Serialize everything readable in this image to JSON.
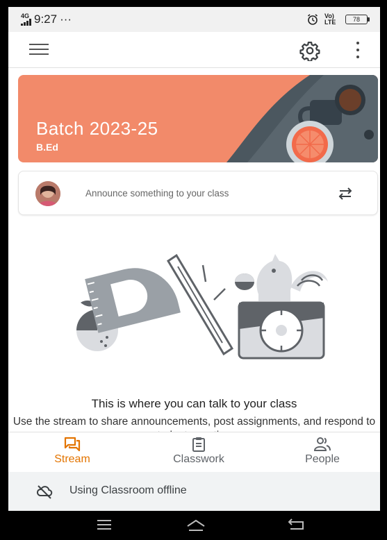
{
  "status_bar": {
    "network": "4G",
    "time": "9:27",
    "dots": "···",
    "volte": "Vo) LTE",
    "battery": "78"
  },
  "appbar": {
    "menu_icon": "hamburger-icon",
    "settings_icon": "gear-icon",
    "more_icon": "more-vert-icon"
  },
  "banner": {
    "class_name": "Batch 2023-25",
    "section": "B.Ed",
    "colors": {
      "background": "#f28a6a",
      "accent": "#4b575f"
    }
  },
  "announce": {
    "placeholder": "Announce something to your class",
    "repost_icon": "swap-arrows-icon"
  },
  "empty_state": {
    "title": "This is where you can talk to your class",
    "body": "Use the stream to share announcements, post assignments, and respond to student questions"
  },
  "bottom_nav": {
    "items": [
      {
        "label": "Stream",
        "icon": "stream-icon",
        "active": true
      },
      {
        "label": "Classwork",
        "icon": "clipboard-icon",
        "active": false
      },
      {
        "label": "People",
        "icon": "people-icon",
        "active": false
      }
    ],
    "active_color": "#e37400"
  },
  "offline": {
    "text": "Using Classroom offline",
    "icon": "cloud-off-icon"
  },
  "system_nav": {
    "recents_icon": "recents-icon",
    "home_icon": "home-icon",
    "back_icon": "back-icon"
  }
}
